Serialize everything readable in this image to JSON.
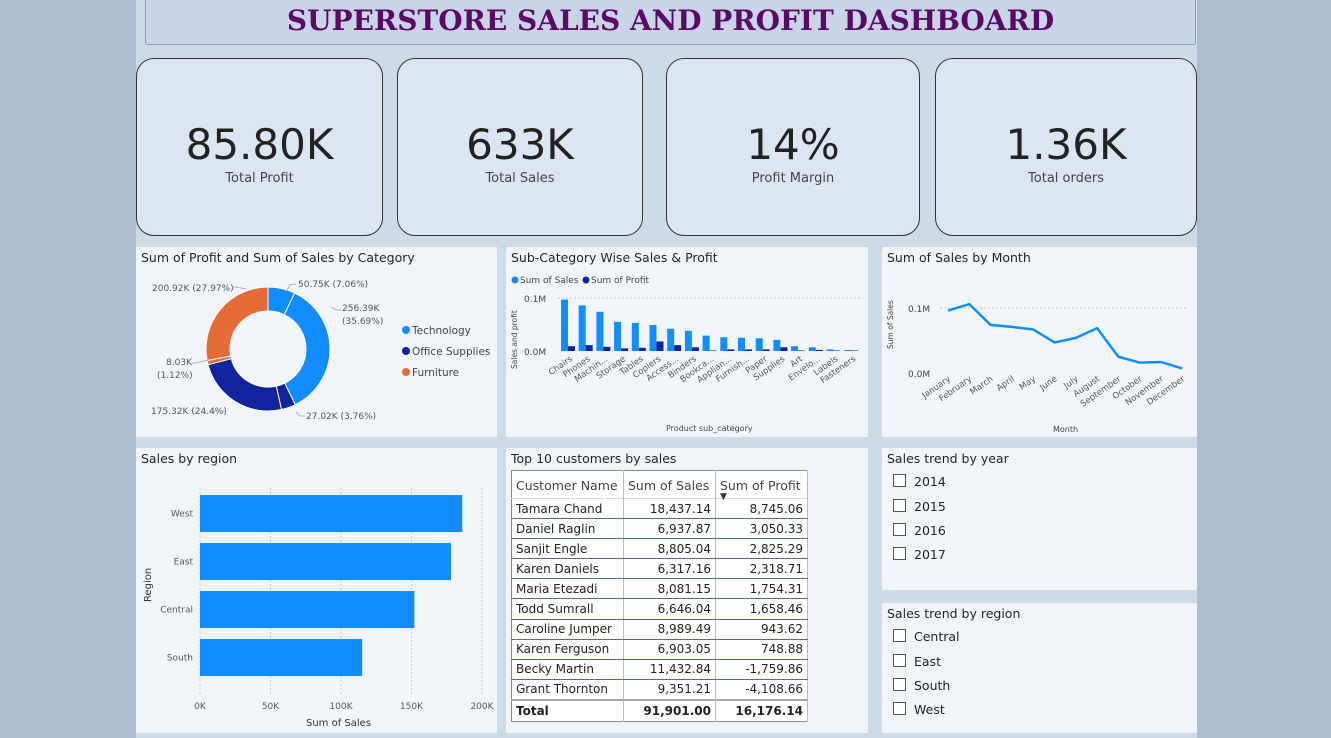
{
  "dashboard": {
    "title": "SUPERSTORE SALES AND PROFIT DASHBOARD"
  },
  "kpis": [
    {
      "value": "85.80K",
      "label": "Total Profit"
    },
    {
      "value": "633K",
      "label": "Total Sales"
    },
    {
      "value": "14%",
      "label": "Profit Margin"
    },
    {
      "value": "1.36K",
      "label": "Total orders"
    }
  ],
  "donut": {
    "title": "Sum of Profit and Sum of Sales by Category",
    "legend": [
      "Technology",
      "Office Supplies",
      "Furniture"
    ],
    "slice_labels": [
      "50.75K (7.06%)",
      "256.39K",
      "(35.69%)",
      "27.02K (3.76%)",
      "175.32K (24.4%)",
      "8.03K",
      "(1.12%)",
      "200.92K (27.97%)"
    ],
    "colors": {
      "technology": "#118dff",
      "office_supplies": "#12239e",
      "furniture": "#e66c37"
    }
  },
  "subcat": {
    "title": "Sub-Category Wise Sales & Profit",
    "legend": [
      "Sum of Sales",
      "Sum of Profit"
    ],
    "ylabel": "Sales and profit",
    "xlabel": "Product sub_category",
    "yticks": [
      "0.1M",
      "0.0M"
    ],
    "tick_labels": [
      "Chairs",
      "Phones",
      "Machin...",
      "Storage",
      "Tables",
      "Copiers",
      "Access...",
      "Binders",
      "Bookca...",
      "Applian...",
      "Furnish...",
      "Paper",
      "Supplies",
      "Art",
      "Envelo...",
      "Labels",
      "Fasteners"
    ]
  },
  "month": {
    "title": "Sum of Sales by Month",
    "ylabel": "Sum of Sales",
    "xlabel": "Month",
    "yticks": [
      "0.1M",
      "0.0M"
    ],
    "months": [
      "January",
      "February",
      "March",
      "April",
      "May",
      "June",
      "July",
      "August",
      "September",
      "October",
      "November",
      "December"
    ]
  },
  "region": {
    "title": "Sales by region",
    "ylabel": "Region",
    "xlabel": "Sum of Sales",
    "xticks": [
      "0K",
      "50K",
      "100K",
      "150K",
      "200K"
    ],
    "categories": [
      "West",
      "East",
      "Central",
      "South"
    ]
  },
  "customers": {
    "title": "Top 10 customers by sales",
    "headers": [
      "Customer Name",
      "Sum of Sales",
      "Sum of Profit"
    ],
    "rows": [
      [
        "Tamara Chand",
        "18,437.14",
        "8,745.06"
      ],
      [
        "Daniel Raglin",
        "6,937.87",
        "3,050.33"
      ],
      [
        "Sanjit Engle",
        "8,805.04",
        "2,825.29"
      ],
      [
        "Karen Daniels",
        "6,317.16",
        "2,318.71"
      ],
      [
        "Maria Etezadi",
        "8,081.15",
        "1,754.31"
      ],
      [
        "Todd Sumrall",
        "6,646.04",
        "1,658.46"
      ],
      [
        "Caroline Jumper",
        "8,989.49",
        "943.62"
      ],
      [
        "Karen Ferguson",
        "6,903.05",
        "748.88"
      ],
      [
        "Becky Martin",
        "11,432.84",
        "-1,759.86"
      ],
      [
        "Grant Thornton",
        "9,351.21",
        "-4,108.66"
      ]
    ],
    "total": [
      "Total",
      "91,901.00",
      "16,176.14"
    ]
  },
  "slicer_year": {
    "title": "Sales trend by year",
    "items": [
      "2014",
      "2015",
      "2016",
      "2017"
    ]
  },
  "slicer_region": {
    "title": "Sales trend by region",
    "items": [
      "Central",
      "East",
      "South",
      "West"
    ]
  },
  "chart_data": [
    {
      "type": "pie",
      "title": "Sum of Profit and Sum of Sales by Category",
      "categories": [
        "Technology",
        "Technology",
        "Office Supplies",
        "Office Supplies",
        "Furniture",
        "Furniture"
      ],
      "values": [
        50750,
        256390,
        27020,
        175320,
        8030,
        200920
      ]
    },
    {
      "type": "bar",
      "title": "Sub-Category Wise Sales & Profit",
      "categories": [
        "Chairs",
        "Phones",
        "Machines",
        "Storage",
        "Tables",
        "Copiers",
        "Accessories",
        "Binders",
        "Bookcases",
        "Appliances",
        "Furnishings",
        "Paper",
        "Supplies",
        "Art",
        "Envelopes",
        "Labels",
        "Fasteners"
      ],
      "series": [
        {
          "name": "Sum of Sales",
          "values": [
            97000,
            86000,
            74000,
            55000,
            53000,
            49000,
            42000,
            38000,
            29000,
            26000,
            25000,
            24000,
            21000,
            9000,
            7000,
            3000,
            2000
          ]
        },
        {
          "name": "Sum of Profit",
          "values": [
            9000,
            11000,
            8000,
            5000,
            6000,
            18000,
            11000,
            7000,
            1000,
            3000,
            3000,
            3000,
            7000,
            1000,
            2000,
            1000,
            1000
          ]
        }
      ],
      "xlabel": "Product sub_category",
      "ylabel": "Sales and profit",
      "ylim": [
        0,
        100000
      ]
    },
    {
      "type": "line",
      "title": "Sum of Sales by Month",
      "categories": [
        "January",
        "February",
        "March",
        "April",
        "May",
        "June",
        "July",
        "August",
        "September",
        "October",
        "November",
        "December"
      ],
      "values": [
        96000,
        106000,
        74000,
        71000,
        67000,
        47000,
        54000,
        69000,
        25000,
        16000,
        17000,
        7000
      ],
      "xlabel": "Month",
      "ylabel": "Sum of Sales",
      "ylim": [
        0,
        100000
      ]
    },
    {
      "type": "bar",
      "title": "Sales by region",
      "categories": [
        "West",
        "East",
        "Central",
        "South"
      ],
      "values": [
        186000,
        178000,
        152000,
        115000
      ],
      "xlabel": "Sum of Sales",
      "ylabel": "Region",
      "xlim": [
        0,
        200000
      ]
    }
  ]
}
